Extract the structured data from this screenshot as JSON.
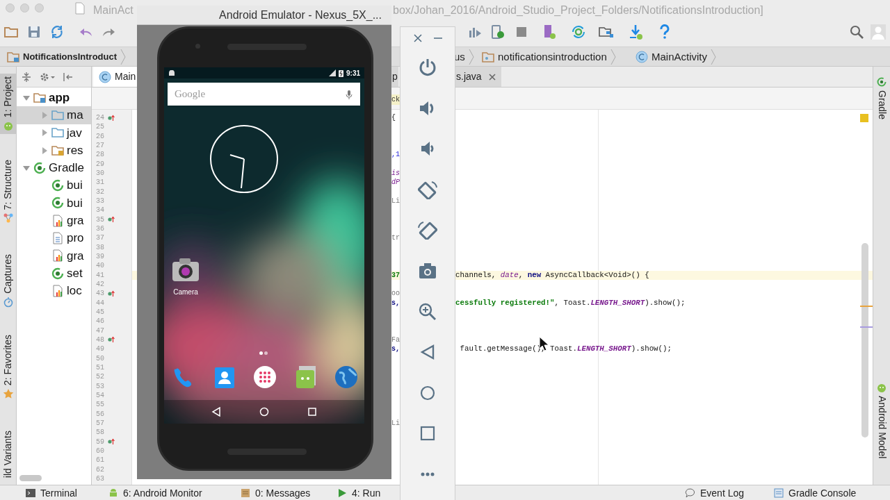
{
  "ide": {
    "title_left": "MainAct",
    "title_right": "box/Johan_2016/Android_Studio_Project_Folders/NotificationsIntroduction]",
    "breadcrumbs": [
      {
        "label": "NotificationsIntroduct",
        "kind": "project"
      },
      {
        "label": "us",
        "kind": "plain"
      },
      {
        "label": "notificationsintroduction",
        "kind": "package"
      },
      {
        "label": "MainActivity",
        "kind": "class"
      }
    ],
    "left_tool_tabs": [
      {
        "label": "1: Project",
        "selected": true,
        "kind": "android"
      },
      {
        "label": "7: Structure",
        "selected": false,
        "kind": "structure"
      },
      {
        "label": "Captures",
        "selected": false,
        "kind": "captures"
      },
      {
        "label": "2: Favorites",
        "selected": false,
        "kind": "star"
      },
      {
        "label": "ild Variants",
        "selected": false,
        "kind": "none"
      }
    ],
    "right_tool_tabs": [
      {
        "label": "Gradle",
        "kind": "gradle"
      },
      {
        "label": "Android Model",
        "kind": "android"
      }
    ],
    "project_tree": [
      {
        "label": "app",
        "kind": "module",
        "expanded": true,
        "selected": false,
        "children": [
          {
            "label": "ma",
            "kind": "folder",
            "expanded": false,
            "selected": true
          },
          {
            "label": "jav",
            "kind": "folder",
            "expanded": false,
            "selected": false
          },
          {
            "label": "res",
            "kind": "res",
            "expanded": false,
            "selected": false
          }
        ]
      },
      {
        "label": "Gradle",
        "kind": "gradle",
        "expanded": true,
        "selected": false,
        "children": [
          {
            "label": "bui",
            "kind": "gradle",
            "selected": false
          },
          {
            "label": "bui",
            "kind": "gradle",
            "selected": false
          },
          {
            "label": "gra",
            "kind": "chart",
            "selected": false
          },
          {
            "label": "pro",
            "kind": "text",
            "selected": false
          },
          {
            "label": "gra",
            "kind": "chart",
            "selected": false
          },
          {
            "label": "set",
            "kind": "gradle",
            "selected": false
          },
          {
            "label": "loc",
            "kind": "chart",
            "selected": false
          }
        ]
      }
    ],
    "editor_tabs": [
      {
        "label": "Main",
        "selected": true,
        "closable": false
      },
      {
        "label": "p",
        "selected": false,
        "closable": false
      },
      {
        "label": "s.java",
        "selected": false,
        "closable": true
      }
    ],
    "editor_header_fragment": "ck",
    "code_lines": [
      {
        "number": "24",
        "marker": true,
        "left": {
          "t": "{",
          "kind": "plain"
        }
      },
      {
        "number": "25"
      },
      {
        "number": "26"
      },
      {
        "number": "27"
      },
      {
        "number": "28",
        "left": {
          "t": ",1",
          "kind": "number"
        }
      },
      {
        "number": "29"
      },
      {
        "number": "30",
        "left": {
          "t": "is",
          "kind": "field"
        }
      },
      {
        "number": "31",
        "left": {
          "t": "dP",
          "kind": "field"
        }
      },
      {
        "number": "32"
      },
      {
        "number": "33",
        "left": {
          "t": "Li",
          "kind": "comment"
        }
      },
      {
        "number": "34"
      },
      {
        "number": "35",
        "marker": true
      },
      {
        "number": "36"
      },
      {
        "number": "37",
        "left": {
          "t": "tr",
          "kind": "comment"
        }
      },
      {
        "number": "38"
      },
      {
        "number": "39"
      },
      {
        "number": "40"
      },
      {
        "number": "41",
        "current": true,
        "left": {
          "t": "37",
          "kind": "string"
        },
        "right": [
          {
            "t": "channels, ",
            "kind": "plain"
          },
          {
            "t": "date",
            "kind": "field"
          },
          {
            "t": ", ",
            "kind": "plain"
          },
          {
            "t": "new",
            "kind": "keyword"
          },
          {
            "t": " AsyncCallback<Void>() {",
            "kind": "plain"
          }
        ]
      },
      {
        "number": "42"
      },
      {
        "number": "43",
        "marker": true,
        "left": {
          "t": "oo",
          "kind": "comment"
        }
      },
      {
        "number": "44",
        "left": {
          "t": "s,",
          "kind": "keyword"
        },
        "right": [
          {
            "t": "cessfully registered!\"",
            "kind": "string"
          },
          {
            "t": ", Toast.",
            "kind": "plain"
          },
          {
            "t": "LENGTH_SHORT",
            "kind": "constant"
          },
          {
            "t": ").show();",
            "kind": "plain"
          }
        ]
      },
      {
        "number": "45"
      },
      {
        "number": "46"
      },
      {
        "number": "47"
      },
      {
        "number": "48",
        "marker": true,
        "left": {
          "t": "Fa",
          "kind": "comment"
        }
      },
      {
        "number": "49",
        "left": {
          "t": "s,",
          "kind": "keyword"
        },
        "right": [
          {
            "t": " fault.getMessage(), Toast.",
            "kind": "plain"
          },
          {
            "t": "LENGTH_SHORT",
            "kind": "constant"
          },
          {
            "t": ").show();",
            "kind": "plain"
          }
        ]
      },
      {
        "number": "50"
      },
      {
        "number": "51"
      },
      {
        "number": "52"
      },
      {
        "number": "53"
      },
      {
        "number": "54"
      },
      {
        "number": "55"
      },
      {
        "number": "56"
      },
      {
        "number": "57",
        "left": {
          "t": "Li",
          "kind": "comment"
        }
      },
      {
        "number": "58"
      },
      {
        "number": "59",
        "marker": true
      },
      {
        "number": "60"
      },
      {
        "number": "61"
      },
      {
        "number": "62"
      },
      {
        "number": "63"
      }
    ],
    "bottom_left": [
      {
        "label": "Terminal",
        "kind": "terminal"
      },
      {
        "label": "6: Android Monitor",
        "kind": "android"
      },
      {
        "label": "0: Messages",
        "kind": "messages"
      },
      {
        "label": "4: Run",
        "kind": "run"
      }
    ],
    "bottom_right": [
      {
        "label": "Event Log",
        "kind": "bubble"
      },
      {
        "label": "Gradle Console",
        "kind": "console"
      }
    ]
  },
  "emulator": {
    "title": "Android Emulator - Nexus_5X_...",
    "time": "9:31",
    "search_placeholder": "Google",
    "home_icons": [
      {
        "label": "Camera",
        "kind": "camera"
      }
    ],
    "dock": [
      {
        "kind": "phone"
      },
      {
        "kind": "contacts"
      },
      {
        "kind": "apps"
      },
      {
        "kind": "messaging"
      },
      {
        "kind": "browser"
      }
    ]
  },
  "emulator_controls": [
    {
      "kind": "power"
    },
    {
      "kind": "volume-up"
    },
    {
      "kind": "volume-down"
    },
    {
      "kind": "rotate-left"
    },
    {
      "kind": "rotate-right"
    },
    {
      "kind": "camera"
    },
    {
      "kind": "zoom"
    },
    {
      "kind": "back"
    },
    {
      "kind": "home"
    },
    {
      "kind": "overview"
    },
    {
      "kind": "more"
    }
  ]
}
